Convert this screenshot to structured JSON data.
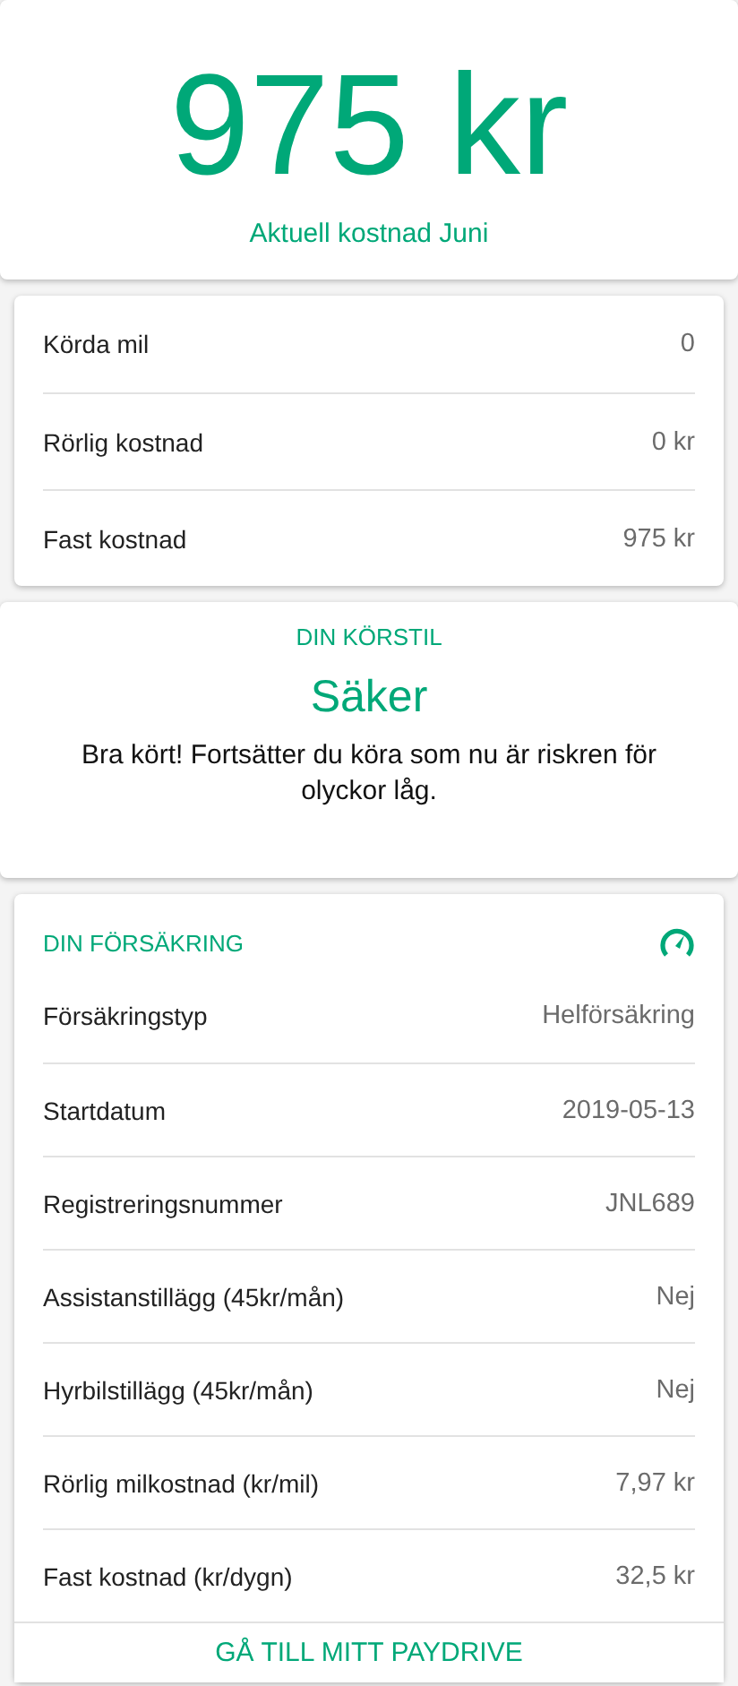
{
  "total": {
    "amount": "975 kr",
    "caption": "Aktuell kostnad Juni"
  },
  "summary": [
    {
      "label": "Körda mil",
      "value": "0"
    },
    {
      "label": "Rörlig kostnad",
      "value": "0 kr"
    },
    {
      "label": "Fast kostnad",
      "value": "975 kr"
    }
  ],
  "driving_style": {
    "heading": "DIN KÖRSTIL",
    "rating": "Säker",
    "message": "Bra kört! Fortsätter du köra som nu är riskren för olyckor låg."
  },
  "insurance": {
    "heading": "DIN FÖRSÄKRING",
    "rows": [
      {
        "label": "Försäkringstyp",
        "value": "Helförsäkring"
      },
      {
        "label": "Startdatum",
        "value": "2019-05-13"
      },
      {
        "label": "Registreringsnummer",
        "value": "JNL689"
      },
      {
        "label": "Assistanstillägg (45kr/mån)",
        "value": "Nej"
      },
      {
        "label": "Hyrbilstillägg (45kr/mån)",
        "value": "Nej"
      },
      {
        "label": "Rörlig milkostnad (kr/mil)",
        "value": "7,97 kr"
      },
      {
        "label": "Fast kostnad (kr/dygn)",
        "value": "32,5 kr"
      }
    ],
    "action": "GÅ TILL MITT PAYDRIVE"
  }
}
